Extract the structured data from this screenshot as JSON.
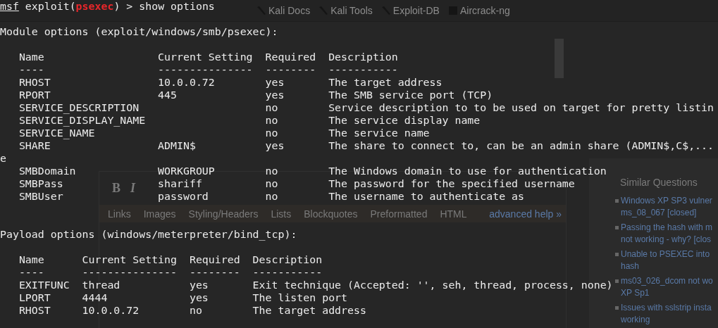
{
  "background_page": {
    "bookmarks": [
      "Kali Docs",
      "Kali Tools",
      "Exploit-DB",
      "Aircrack-ng"
    ],
    "editor_buttons": [
      "B",
      "I"
    ],
    "editor_tabs": [
      "Links",
      "Images",
      "Styling/Headers",
      "Lists",
      "Blockquotes",
      "Preformatted",
      "HTML"
    ],
    "editor_help_link": "advanced help »",
    "similar_heading": "Similar Questions",
    "similar_questions": [
      [
        "Windows XP SP3 vulner",
        "ms_08_067 [closed]"
      ],
      [
        "Passing the hash with m",
        "not working - why? [clos"
      ],
      [
        "Unable to PSEXEC into",
        "hash"
      ],
      [
        "ms03_026_dcom not wo",
        "XP Sp1"
      ],
      [
        "Issues with sslstrip insta",
        "working"
      ]
    ]
  },
  "terminal": {
    "prompt": [
      {
        "kind": "context",
        "text": "msf"
      },
      {
        "kind": "plain",
        "text": " exploit("
      },
      {
        "kind": "module",
        "text": "psexec"
      },
      {
        "kind": "plain",
        "text": ") > show options"
      }
    ],
    "sections": [
      {
        "heading": "Module options (exploit/windows/smb/psexec):",
        "columns": [
          "Name",
          "Current Setting",
          "Required",
          "Description"
        ],
        "underline": [
          "----",
          "---------------",
          "--------",
          "-----------"
        ],
        "rows": [
          [
            "RHOST",
            "10.0.0.72",
            "yes",
            "The target address"
          ],
          [
            "RPORT",
            "445",
            "yes",
            "The SMB service port (TCP)"
          ],
          [
            "SERVICE_DESCRIPTION",
            "",
            "no",
            "Service description to to be used on target for pretty listin"
          ],
          [
            "SERVICE_DISPLAY_NAME",
            "",
            "no",
            "The service display name"
          ],
          [
            "SERVICE_NAME",
            "",
            "no",
            "The service name"
          ],
          [
            "SHARE",
            "ADMIN$",
            "yes",
            "The share to connect to, can be an admin share (ADMIN$,C$,..."
          ],
          {
            "kind": "wrap",
            "text": "e"
          },
          [
            "SMBDomain",
            "WORKGROUP",
            "no",
            "The Windows domain to use for authentication"
          ],
          [
            "SMBPass",
            "shariff",
            "no",
            "The password for the specified username"
          ],
          [
            "SMBUser",
            "password",
            "no",
            "The username to authenticate as"
          ]
        ]
      },
      {
        "heading": "Payload options (windows/meterpreter/bind_tcp):",
        "columns": [
          "Name",
          "Current Setting",
          "Required",
          "Description"
        ],
        "underline": [
          "----",
          "---------------",
          "--------",
          "-----------"
        ],
        "rows": [
          [
            "EXITFUNC",
            "thread",
            "yes",
            "Exit technique (Accepted: '', seh, thread, process, none)"
          ],
          [
            "LPORT",
            "4444",
            "yes",
            "The listen port"
          ],
          [
            "RHOST",
            "10.0.0.72",
            "no",
            "The target address"
          ]
        ]
      }
    ]
  }
}
